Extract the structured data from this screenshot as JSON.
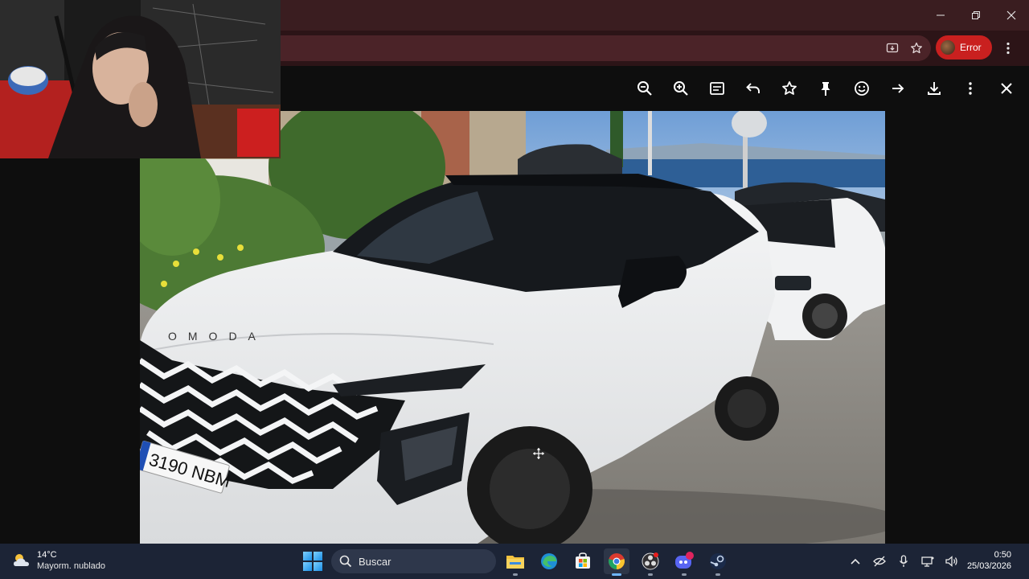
{
  "browser": {
    "profile_label": "Error",
    "omnibox_icons": [
      "install-app-icon",
      "bookmark-star-icon"
    ]
  },
  "viewer": {
    "toolbar": [
      "zoom-out-icon",
      "zoom-in-icon",
      "caption-icon",
      "undo-icon",
      "star-icon",
      "pin-icon",
      "emoji-icon",
      "forward-arrow-icon",
      "download-icon",
      "more-vert-icon",
      "close-icon"
    ]
  },
  "photo": {
    "plate": "3190 NBM",
    "brand_letters": "OMODA"
  },
  "taskbar": {
    "weather_temp": "14°C",
    "weather_desc": "Mayorm. nublado",
    "search_placeholder": "Buscar",
    "apps": [
      "file-explorer",
      "edge",
      "microsoft-store",
      "chrome",
      "obs",
      "discord",
      "steam"
    ],
    "discord_badge": "+",
    "clock_time": "0:50",
    "clock_date": "25/03/2026"
  },
  "colors": {
    "titlebar": "#3a1d20",
    "error_chip": "#c9201f",
    "taskbar": "#1c2436"
  }
}
